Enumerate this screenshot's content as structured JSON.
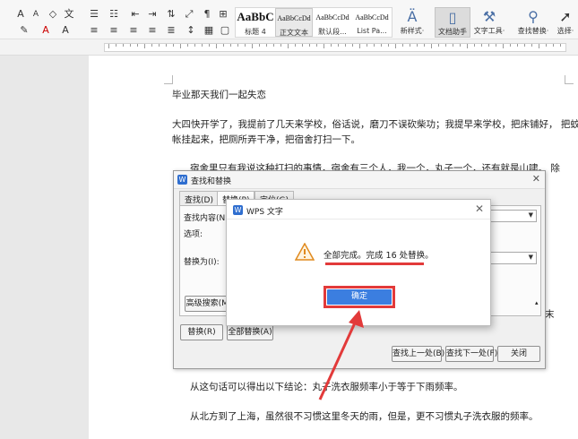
{
  "ribbon": {
    "styles": [
      {
        "sample": "AaBbC",
        "name": "标题 4"
      },
      {
        "sample": "AaBbCcDd",
        "name": "正文文本"
      },
      {
        "sample": "AaBbCcDd",
        "name": "默认段..."
      },
      {
        "sample": "AaBbCcDd",
        "name": "List Pa..."
      }
    ],
    "new_style_label": "新样式·",
    "doc_assistant_label": "文档助手",
    "text_tools_label": "文字工具·",
    "find_replace_label": "查找替换·",
    "select_label": "选择·"
  },
  "document": {
    "lines": [
      "毕业那天我们一起失恋",
      "大四快开学了，我提前了几天来学校，俗话说，磨刀不误砍柴功；我提早来学校，把床铺好，    把蚊",
      "帐挂起来，把厕所弄干净，把宿舍打扫一下。",
      "宿舍里只有我说这种打扫的事情，宿舍有三个人，我一个，丸子一个，还有就是山啸。   除",
      "从这句话可以得出以下结论：丸子洗衣服频率小于等于下雨频率。",
      "从北方到了上海，虽然很不习惯这里冬天的雨，但是，更不习惯丸子洗衣服的频率。"
    ],
    "side_char_1": "末"
  },
  "find_replace": {
    "title": "查找和替换",
    "tabs": [
      "查找(D)",
      "替换(P)",
      "定位(G)"
    ],
    "find_label": "查找内容(N):",
    "options_label": "选项:",
    "replace_label": "替换为(I):",
    "advanced_button": "高级搜索(M)",
    "replace_button": "替换(R)",
    "replace_all_button": "全部替换(A)",
    "find_prev_button": "查找上一处(B)",
    "find_next_button": "查找下一处(F)",
    "close_button": "关闭"
  },
  "message_box": {
    "title": "WPS 文字",
    "message": "全部完成。完成 16 处替换。",
    "ok_button": "确定"
  },
  "colors": {
    "accent_blue": "#3b7ee0",
    "highlight_red": "#e23a3a"
  }
}
